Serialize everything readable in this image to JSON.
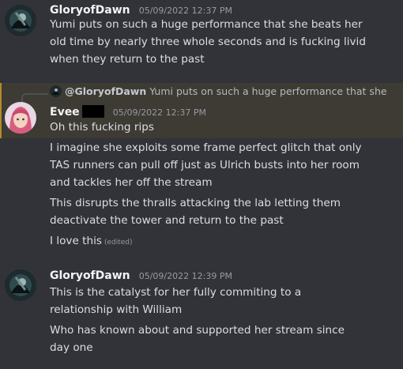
{
  "messages": [
    {
      "username": "GloryofDawn",
      "timestamp": "05/09/2022 12:37 PM",
      "lines": [
        "Yumi puts on such a huge performance that she beats her",
        "old time by nearly three whole seconds and is fucking livid",
        "when they return to the past"
      ]
    },
    {
      "reply": {
        "username": "@GloryofDawn",
        "snippet": "Yumi puts on such a huge performance that she"
      },
      "username": "Evee",
      "timestamp": "05/09/2022 12:37 PM",
      "lines": [
        "Oh this fucking rips",
        "I imagine she exploits some frame perfect glitch that only",
        "TAS runners can pull off just as Ulrich busts into her room",
        "and tackles her off the stream",
        "This disrupts the thralls attacking the lab letting them",
        "deactivate the tower and return to the past",
        "I love this"
      ],
      "edited_label": "(edited)"
    },
    {
      "username": "GloryofDawn",
      "timestamp": "05/09/2022 12:39 PM",
      "lines": [
        "This is the catalyst for her fully commiting to a",
        "relationship with William",
        "Who has known about and supported her stream since",
        "day one"
      ]
    }
  ],
  "colors": {
    "background": "#313338",
    "highlight": "#3d3b33",
    "highlight_bar": "#b28b2c",
    "username": "#f2f3f5",
    "timestamp": "#949ba4"
  }
}
